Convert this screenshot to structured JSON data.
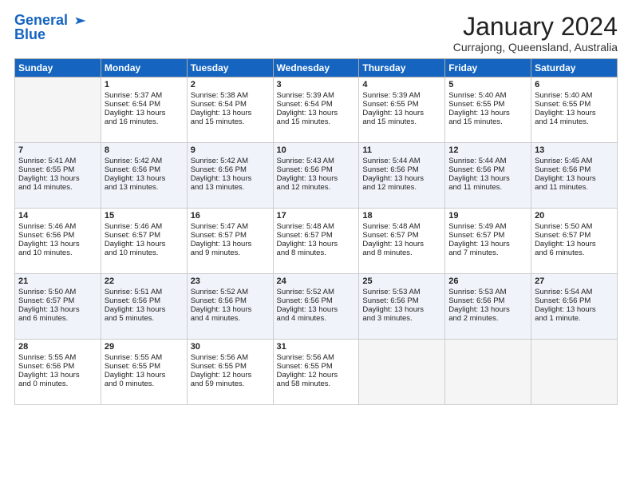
{
  "logo": {
    "line1": "General",
    "line2": "Blue"
  },
  "header": {
    "title": "January 2024",
    "location": "Currajong, Queensland, Australia"
  },
  "days_of_week": [
    "Sunday",
    "Monday",
    "Tuesday",
    "Wednesday",
    "Thursday",
    "Friday",
    "Saturday"
  ],
  "weeks": [
    [
      {
        "day": "",
        "info": ""
      },
      {
        "day": "1",
        "info": "Sunrise: 5:37 AM\nSunset: 6:54 PM\nDaylight: 13 hours\nand 16 minutes."
      },
      {
        "day": "2",
        "info": "Sunrise: 5:38 AM\nSunset: 6:54 PM\nDaylight: 13 hours\nand 15 minutes."
      },
      {
        "day": "3",
        "info": "Sunrise: 5:39 AM\nSunset: 6:54 PM\nDaylight: 13 hours\nand 15 minutes."
      },
      {
        "day": "4",
        "info": "Sunrise: 5:39 AM\nSunset: 6:55 PM\nDaylight: 13 hours\nand 15 minutes."
      },
      {
        "day": "5",
        "info": "Sunrise: 5:40 AM\nSunset: 6:55 PM\nDaylight: 13 hours\nand 15 minutes."
      },
      {
        "day": "6",
        "info": "Sunrise: 5:40 AM\nSunset: 6:55 PM\nDaylight: 13 hours\nand 14 minutes."
      }
    ],
    [
      {
        "day": "7",
        "info": "Sunrise: 5:41 AM\nSunset: 6:55 PM\nDaylight: 13 hours\nand 14 minutes."
      },
      {
        "day": "8",
        "info": "Sunrise: 5:42 AM\nSunset: 6:56 PM\nDaylight: 13 hours\nand 13 minutes."
      },
      {
        "day": "9",
        "info": "Sunrise: 5:42 AM\nSunset: 6:56 PM\nDaylight: 13 hours\nand 13 minutes."
      },
      {
        "day": "10",
        "info": "Sunrise: 5:43 AM\nSunset: 6:56 PM\nDaylight: 13 hours\nand 12 minutes."
      },
      {
        "day": "11",
        "info": "Sunrise: 5:44 AM\nSunset: 6:56 PM\nDaylight: 13 hours\nand 12 minutes."
      },
      {
        "day": "12",
        "info": "Sunrise: 5:44 AM\nSunset: 6:56 PM\nDaylight: 13 hours\nand 11 minutes."
      },
      {
        "day": "13",
        "info": "Sunrise: 5:45 AM\nSunset: 6:56 PM\nDaylight: 13 hours\nand 11 minutes."
      }
    ],
    [
      {
        "day": "14",
        "info": "Sunrise: 5:46 AM\nSunset: 6:56 PM\nDaylight: 13 hours\nand 10 minutes."
      },
      {
        "day": "15",
        "info": "Sunrise: 5:46 AM\nSunset: 6:57 PM\nDaylight: 13 hours\nand 10 minutes."
      },
      {
        "day": "16",
        "info": "Sunrise: 5:47 AM\nSunset: 6:57 PM\nDaylight: 13 hours\nand 9 minutes."
      },
      {
        "day": "17",
        "info": "Sunrise: 5:48 AM\nSunset: 6:57 PM\nDaylight: 13 hours\nand 8 minutes."
      },
      {
        "day": "18",
        "info": "Sunrise: 5:48 AM\nSunset: 6:57 PM\nDaylight: 13 hours\nand 8 minutes."
      },
      {
        "day": "19",
        "info": "Sunrise: 5:49 AM\nSunset: 6:57 PM\nDaylight: 13 hours\nand 7 minutes."
      },
      {
        "day": "20",
        "info": "Sunrise: 5:50 AM\nSunset: 6:57 PM\nDaylight: 13 hours\nand 6 minutes."
      }
    ],
    [
      {
        "day": "21",
        "info": "Sunrise: 5:50 AM\nSunset: 6:57 PM\nDaylight: 13 hours\nand 6 minutes."
      },
      {
        "day": "22",
        "info": "Sunrise: 5:51 AM\nSunset: 6:56 PM\nDaylight: 13 hours\nand 5 minutes."
      },
      {
        "day": "23",
        "info": "Sunrise: 5:52 AM\nSunset: 6:56 PM\nDaylight: 13 hours\nand 4 minutes."
      },
      {
        "day": "24",
        "info": "Sunrise: 5:52 AM\nSunset: 6:56 PM\nDaylight: 13 hours\nand 4 minutes."
      },
      {
        "day": "25",
        "info": "Sunrise: 5:53 AM\nSunset: 6:56 PM\nDaylight: 13 hours\nand 3 minutes."
      },
      {
        "day": "26",
        "info": "Sunrise: 5:53 AM\nSunset: 6:56 PM\nDaylight: 13 hours\nand 2 minutes."
      },
      {
        "day": "27",
        "info": "Sunrise: 5:54 AM\nSunset: 6:56 PM\nDaylight: 13 hours\nand 1 minute."
      }
    ],
    [
      {
        "day": "28",
        "info": "Sunrise: 5:55 AM\nSunset: 6:56 PM\nDaylight: 13 hours\nand 0 minutes."
      },
      {
        "day": "29",
        "info": "Sunrise: 5:55 AM\nSunset: 6:55 PM\nDaylight: 13 hours\nand 0 minutes."
      },
      {
        "day": "30",
        "info": "Sunrise: 5:56 AM\nSunset: 6:55 PM\nDaylight: 12 hours\nand 59 minutes."
      },
      {
        "day": "31",
        "info": "Sunrise: 5:56 AM\nSunset: 6:55 PM\nDaylight: 12 hours\nand 58 minutes."
      },
      {
        "day": "",
        "info": ""
      },
      {
        "day": "",
        "info": ""
      },
      {
        "day": "",
        "info": ""
      }
    ]
  ]
}
